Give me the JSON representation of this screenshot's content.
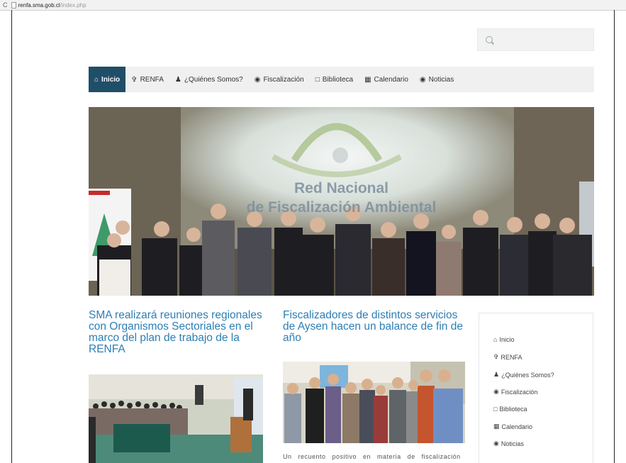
{
  "browser": {
    "url_host": "renfa.sma.gob.cl",
    "url_path": "/index.php"
  },
  "search": {
    "placeholder": ""
  },
  "nav": {
    "items": [
      {
        "label": "Inicio",
        "icon": "home-icon",
        "active": true
      },
      {
        "label": "RENFA",
        "icon": "tree-icon",
        "active": false
      },
      {
        "label": "¿Quiénes Somos?",
        "icon": "user-icon",
        "active": false
      },
      {
        "label": "Fiscalización",
        "icon": "eye-icon",
        "active": false
      },
      {
        "label": "Biblioteca",
        "icon": "file-icon",
        "active": false
      },
      {
        "label": "Calendario",
        "icon": "calendar-icon",
        "active": false
      },
      {
        "label": "Noticias",
        "icon": "globe-icon",
        "active": false
      }
    ]
  },
  "hero": {
    "line1": "Red Nacional",
    "line2": "de Fiscalización Ambiental"
  },
  "articles": [
    {
      "title": "SMA realizará reuniones regionales con Organismos Sectoriales en el marco del plan de trabajo de la RENFA"
    },
    {
      "title": "Fiscalizadores de distintos servicios de Aysen hacen un balance de fin de año",
      "excerpt": "Un recuento positivo en materia de fiscalización"
    }
  ],
  "sidebar": {
    "items": [
      {
        "label": "Inicio",
        "icon": "home-icon"
      },
      {
        "label": "RENFA",
        "icon": "tree-icon"
      },
      {
        "label": "¿Quiénes Somos?",
        "icon": "user-icon"
      },
      {
        "label": "Fiscalización",
        "icon": "eye-icon"
      },
      {
        "label": "Biblioteca",
        "icon": "file-icon"
      },
      {
        "label": "Calendario",
        "icon": "calendar-icon"
      },
      {
        "label": "Noticias",
        "icon": "globe-icon"
      }
    ]
  },
  "colors": {
    "nav_active": "#1f4e68",
    "link_blue": "#2c7fb5"
  }
}
